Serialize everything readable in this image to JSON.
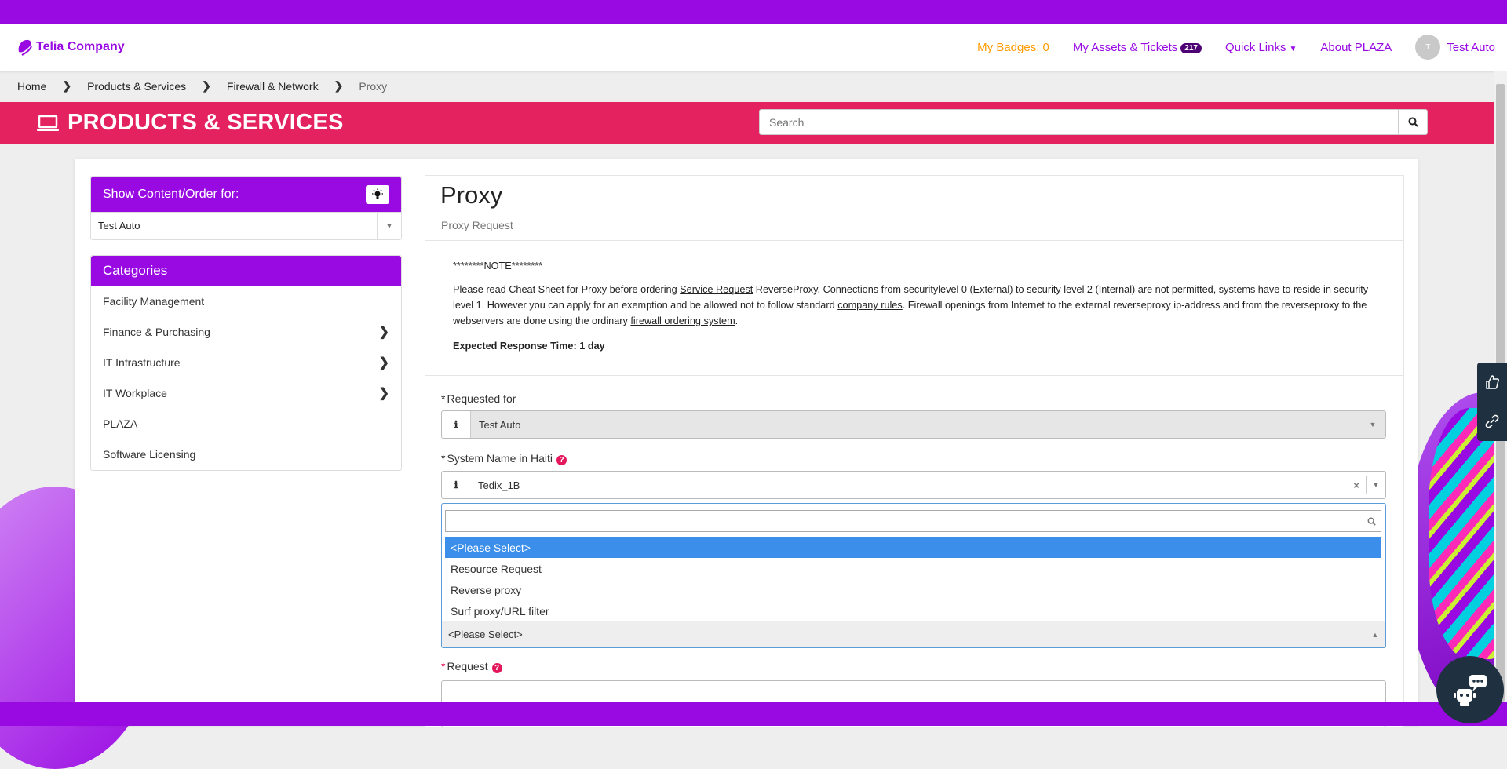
{
  "header": {
    "logo_text": "Telia Company",
    "nav": {
      "badges": "My Badges: 0",
      "assets": "My Assets & Tickets",
      "assets_count": "217",
      "quick_links": "Quick Links",
      "about": "About PLAZA",
      "user_initial": "T",
      "user_name": "Test Auto"
    }
  },
  "breadcrumb": [
    "Home",
    "Products & Services",
    "Firewall & Network",
    "Proxy"
  ],
  "banner": {
    "title": "PRODUCTS & SERVICES",
    "search_placeholder": "Search"
  },
  "sidebar": {
    "show_content_title": "Show Content/Order for:",
    "show_content_value": "Test Auto",
    "categories_title": "Categories",
    "categories": [
      {
        "label": "Facility Management",
        "has_children": false
      },
      {
        "label": "Finance & Purchasing",
        "has_children": true
      },
      {
        "label": "IT Infrastructure",
        "has_children": true
      },
      {
        "label": "IT Workplace",
        "has_children": true
      },
      {
        "label": "PLAZA",
        "has_children": false
      },
      {
        "label": "Software Licensing",
        "has_children": false
      }
    ]
  },
  "main": {
    "title": "Proxy",
    "subtitle": "Proxy Request",
    "note": {
      "heading": "********NOTE********",
      "p1": "Please read Cheat Sheet for Proxy before ordering ",
      "link1": "Service Request",
      "p2": " ReverseProxy. Connections from securitylevel 0 (External) to security level 2 (Internal) are not permitted, systems have to reside in security level 1. However you can apply for an exemption and be allowed not to follow standard ",
      "link2": "company rules",
      "p3": ". Firewall openings from Internet to the external reverseproxy ip-address and from the reverseproxy to the webservers are done using the ordinary ",
      "link3": "firewall ordering system",
      "p4": ".",
      "response_time": "Expected Response Time: 1 day"
    },
    "fields": {
      "requested_for_label": "Requested for",
      "requested_for_value": "Test Auto",
      "system_name_label": "System Name in Haiti",
      "system_name_value": "Tedix_1B",
      "type_value": "<Please Select>",
      "request_label": "Request"
    },
    "dropdown_options": [
      "<Please Select>",
      "Resource Request",
      "Reverse proxy",
      "Surf proxy/URL filter"
    ],
    "dropdown_selected": 0
  },
  "colors": {
    "brand_purple": "#990ae3",
    "banner_pink": "#e4225f",
    "badge_orange": "#ff9b00",
    "highlight_blue": "#3b8eea"
  }
}
